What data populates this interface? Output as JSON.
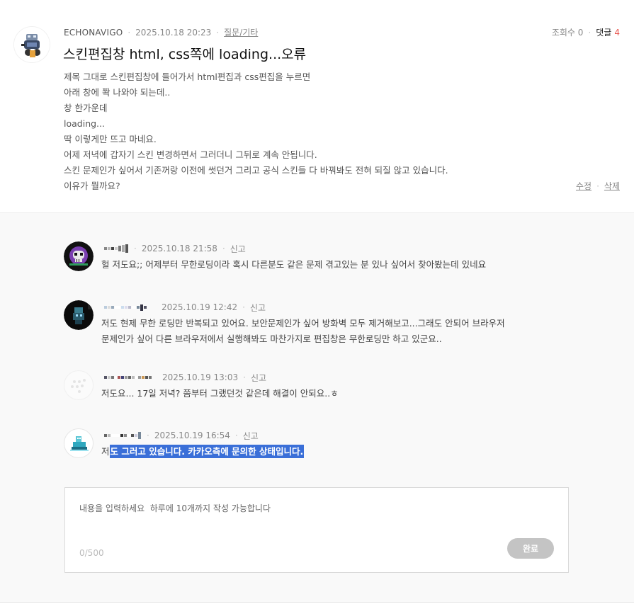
{
  "post": {
    "author": "ECHONAVIGO",
    "datetime": "2025.10.18 20:23",
    "category": "질문/기타",
    "views_label": "조회수",
    "views": "0",
    "comments_label": "댓글",
    "comments_count": "4",
    "title": "스킨편집창 html, css쪽에 loading...오류",
    "body": [
      "제목 그대로 스킨편집창에 들어가서 html편집과 css편집을 누르면",
      "아래 창에 쫙 나와야 되는데..",
      "창 한가운데",
      "loading...",
      "딱 이렇게만 뜨고 마네요.",
      "어제 저녁에 갑자기 스킨 변경하면서 그러더니 그뒤로 계속 안됩니다.",
      "스킨 문제인가 싶어서 기존꺼랑 이전에 썻던거 그리고 공식 스킨들 다 바꿔봐도 전혀 되질 않고 있습니다.",
      "이유가 뭘까요?"
    ],
    "edit_label": "수정",
    "delete_label": "삭제"
  },
  "comments": [
    {
      "datetime": "2025.10.18 21:58",
      "report_label": "신고",
      "lines": [
        "헐 저도요;; 어제부터 무한로딩이라 혹시 다른분도 같은 문제 겪고있는 분 있나 싶어서 찾아봤는데 있네요"
      ]
    },
    {
      "datetime": "2025.10.19 12:42",
      "report_label": "신고",
      "lines": [
        "저도 현제 무한 로딩만 반복되고 있어요. 보안문제인가 싶어 방화벽 모두 제거해보고...그래도 안되어 브라우저",
        "문제인가 싶어 다른 브라우저에서 실행해봐도 마찬가지로 편집창은 무한로딩만 하고 있군요.."
      ]
    },
    {
      "datetime": "2025.10.19 13:03",
      "report_label": "신고",
      "lines": [
        "저도요... 17일 저녁? 쯤부터 그랬던것 같은데 해결이 안되요..ㅎ"
      ]
    },
    {
      "datetime": "2025.10.19 16:54",
      "report_label": "신고",
      "text_plain": "저",
      "text_selected": "도 그러고 있습니다. 카카오측에 문의한 상태입니다."
    }
  ],
  "editor": {
    "placeholder": "내용을 입력하세요  하루에 10개까지 작성 가능합니다",
    "counter": "0/500",
    "submit_label": "완료"
  },
  "colors": {
    "accent_red": "#e8544d",
    "selection_blue": "#3a6fd8",
    "submit_gray": "#c4c4c4"
  },
  "icons": {
    "post_avatar": "robot-character-avatar",
    "comment_avatars": [
      "purple-skull-avatar",
      "dark-character-avatar",
      "dotted-placeholder-avatar",
      "boat-character-avatar"
    ]
  }
}
